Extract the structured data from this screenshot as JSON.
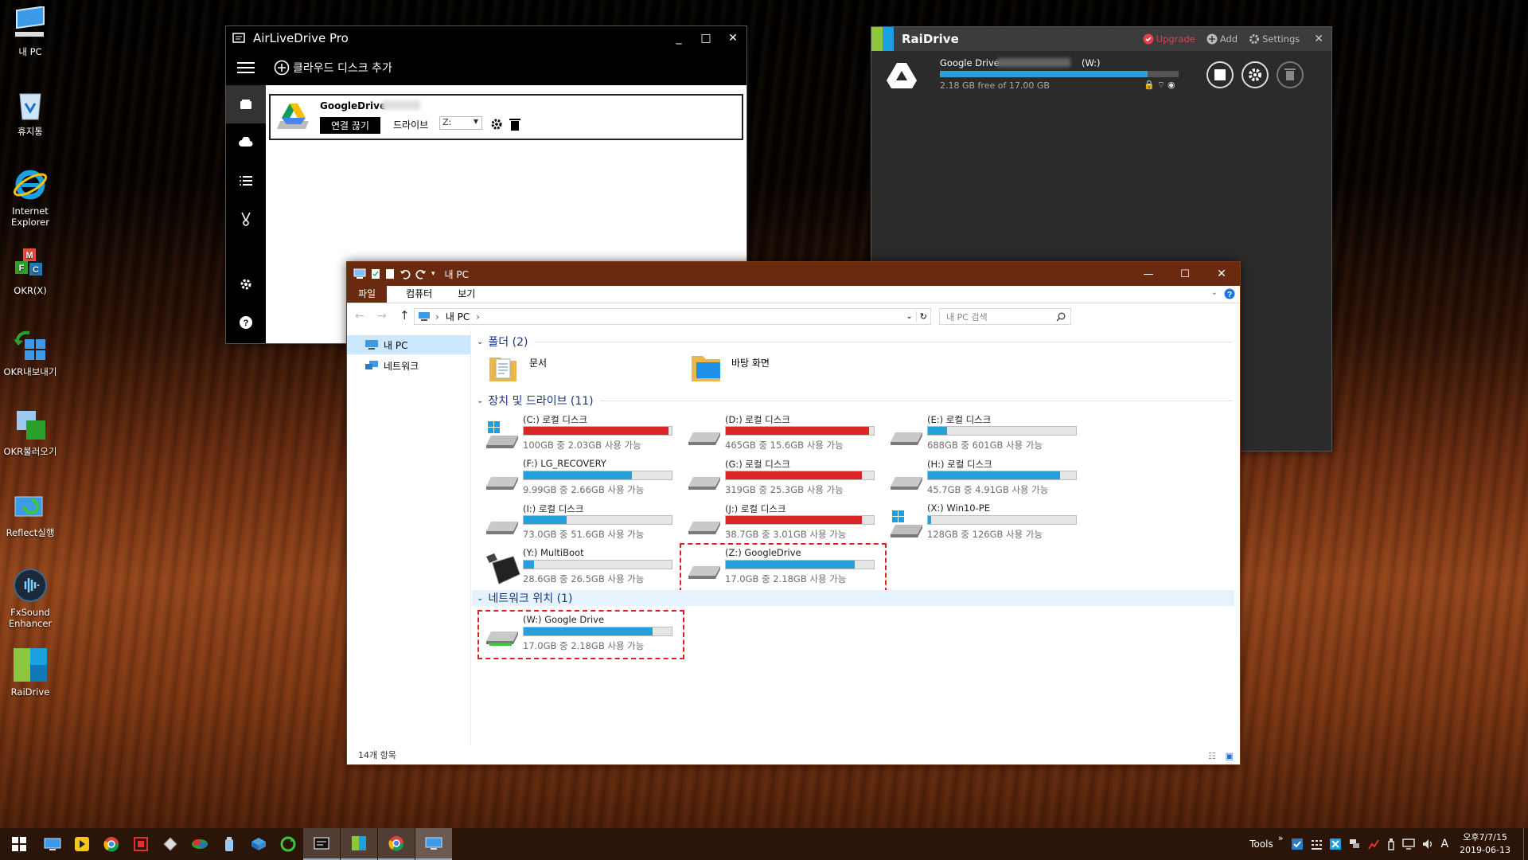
{
  "desktop": {
    "icons": [
      {
        "label": "내 PC",
        "icon": "computer-icon"
      },
      {
        "label": "휴지통",
        "icon": "recycle-bin-icon"
      },
      {
        "label": "Internet Explorer",
        "icon": "internet-explorer-icon"
      },
      {
        "label": "OKR(X)",
        "icon": "okr-icon"
      },
      {
        "label": "OKR내보내기",
        "icon": "okr-export-icon"
      },
      {
        "label": "OKR불러오기",
        "icon": "okr-import-icon"
      },
      {
        "label": "Reflect실행",
        "icon": "reflect-icon"
      },
      {
        "label": "FxSound Enhancer",
        "icon": "fxsound-icon"
      },
      {
        "label": "RaiDrive",
        "icon": "raidrive-icon"
      }
    ]
  },
  "airlivedrive": {
    "title": "AirLiveDrive Pro",
    "add_label": "클라우드 디스크 추가",
    "drive_name": "GoogleDrive",
    "disconnect_label": "연결 끊기",
    "drive_label": "드라이브",
    "drive_letter": "Z:",
    "window_min": "_",
    "window_max": "□",
    "window_close": "✕"
  },
  "raidrive": {
    "title": "RaiDrive",
    "upgrade_label": "Upgrade",
    "add_label": "Add",
    "settings_label": "Settings",
    "drive_name": "Google Drive",
    "drive_letter": "(W:)",
    "free_text": "2.18 GB free of 17.00 GB",
    "usage_fraction": 0.87,
    "close": "✕"
  },
  "explorer": {
    "title": "내 PC",
    "tabs": [
      "파일",
      "컴퓨터",
      "보기"
    ],
    "address": "내 PC",
    "search_placeholder": "내 PC 검색",
    "nav": [
      {
        "label": "내 PC"
      },
      {
        "label": "네트워크"
      }
    ],
    "folders_header": "폴더 (2)",
    "folders": [
      {
        "label": "문서"
      },
      {
        "label": "바탕 화면"
      }
    ],
    "drives_header": "장치 및 드라이브 (11)",
    "drives": [
      {
        "name": "(C:) 로컬 디스크",
        "cap": "100GB 중 2.03GB 사용 가능",
        "used": 0.98,
        "color": "#da2626",
        "icon": "windows-drive-icon"
      },
      {
        "name": "(D:) 로컬 디스크",
        "cap": "465GB 중 15.6GB 사용 가능",
        "used": 0.97,
        "color": "#da2626",
        "icon": "hard-drive-icon"
      },
      {
        "name": "(E:) 로컬 디스크",
        "cap": "688GB 중 601GB 사용 가능",
        "used": 0.13,
        "color": "#26a0da",
        "icon": "hard-drive-icon"
      },
      {
        "name": "(F:) LG_RECOVERY",
        "cap": "9.99GB 중 2.66GB 사용 가능",
        "used": 0.73,
        "color": "#26a0da",
        "icon": "hard-drive-icon"
      },
      {
        "name": "(G:) 로컬 디스크",
        "cap": "319GB 중 25.3GB 사용 가능",
        "used": 0.92,
        "color": "#da2626",
        "icon": "hard-drive-icon"
      },
      {
        "name": "(H:) 로컬 디스크",
        "cap": "45.7GB 중 4.91GB 사용 가능",
        "used": 0.89,
        "color": "#26a0da",
        "icon": "hard-drive-icon"
      },
      {
        "name": "(I:) 로컬 디스크",
        "cap": "73.0GB 중 51.6GB 사용 가능",
        "used": 0.29,
        "color": "#26a0da",
        "icon": "hard-drive-icon"
      },
      {
        "name": "(J:) 로컬 디스크",
        "cap": "38.7GB 중 3.01GB 사용 가능",
        "used": 0.92,
        "color": "#da2626",
        "icon": "hard-drive-icon"
      },
      {
        "name": "(X:) Win10-PE",
        "cap": "128GB 중 126GB 사용 가능",
        "used": 0.02,
        "color": "#26a0da",
        "icon": "windows-drive-icon"
      },
      {
        "name": "(Y:) MultiBoot",
        "cap": "28.6GB 중 26.5GB 사용 가능",
        "used": 0.07,
        "color": "#26a0da",
        "icon": "external-drive-icon"
      },
      {
        "name": "(Z:) GoogleDrive",
        "cap": "17.0GB 중 2.18GB 사용 가능",
        "used": 0.87,
        "color": "#26a0da",
        "icon": "hard-drive-icon"
      }
    ],
    "network_header": "네트워크 위치 (1)",
    "network": [
      {
        "name": "(W:) Google Drive",
        "cap": "17.0GB 중 2.18GB 사용 가능",
        "used": 0.87,
        "color": "#26a0da",
        "icon": "network-drive-icon"
      }
    ],
    "status": "14개 항목"
  },
  "taskbar": {
    "tools_label": "Tools",
    "time": "오후7/7/15",
    "date": "2019-06-13",
    "ime": "A",
    "chevron": "»"
  },
  "colors": {
    "explorer_accent": "#6a2a10",
    "bar_blue": "#26a0da",
    "bar_red": "#da2626",
    "highlight_dash": "#e02020"
  }
}
